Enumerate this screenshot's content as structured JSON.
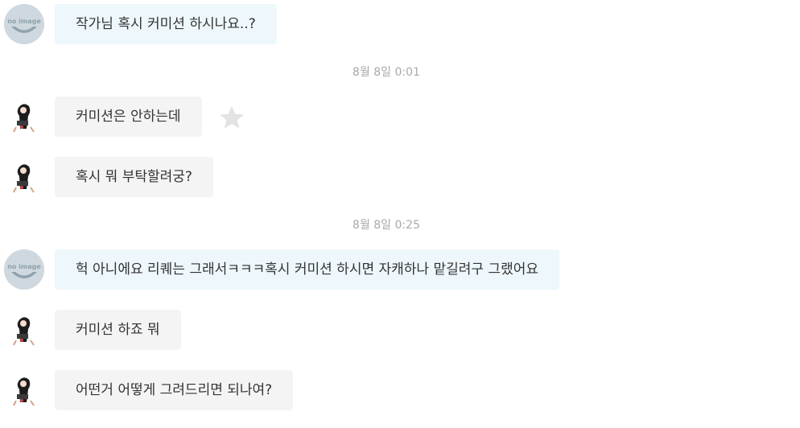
{
  "messages": [
    {
      "sender": "user",
      "text": "작가님 혹시 커미션 하시나요..?"
    },
    {
      "sender": "artist",
      "text": "커미션은 안하는데"
    },
    {
      "sender": "artist",
      "text": "혹시 뭐 부탁할려궁?"
    },
    {
      "sender": "user",
      "text": "헉 아니에요 리퀘는 그래서ㅋㅋㅋ혹시 커미션 하시면 자캐하나 맡길려구 그랬어요"
    },
    {
      "sender": "artist",
      "text": "커미션 하죠 뭐"
    },
    {
      "sender": "artist",
      "text": "어떤거 어떻게 그려드리면 되나여?"
    }
  ],
  "dividers": [
    "8월 8일 0:01",
    "8월 8일 0:25"
  ],
  "avatar_placeholder_text": "no image",
  "colors": {
    "mine_bubble": "#eef7fb",
    "their_bubble": "#f4f4f4",
    "timestamp": "#a9a9a9",
    "star": "#e3e3e3"
  }
}
